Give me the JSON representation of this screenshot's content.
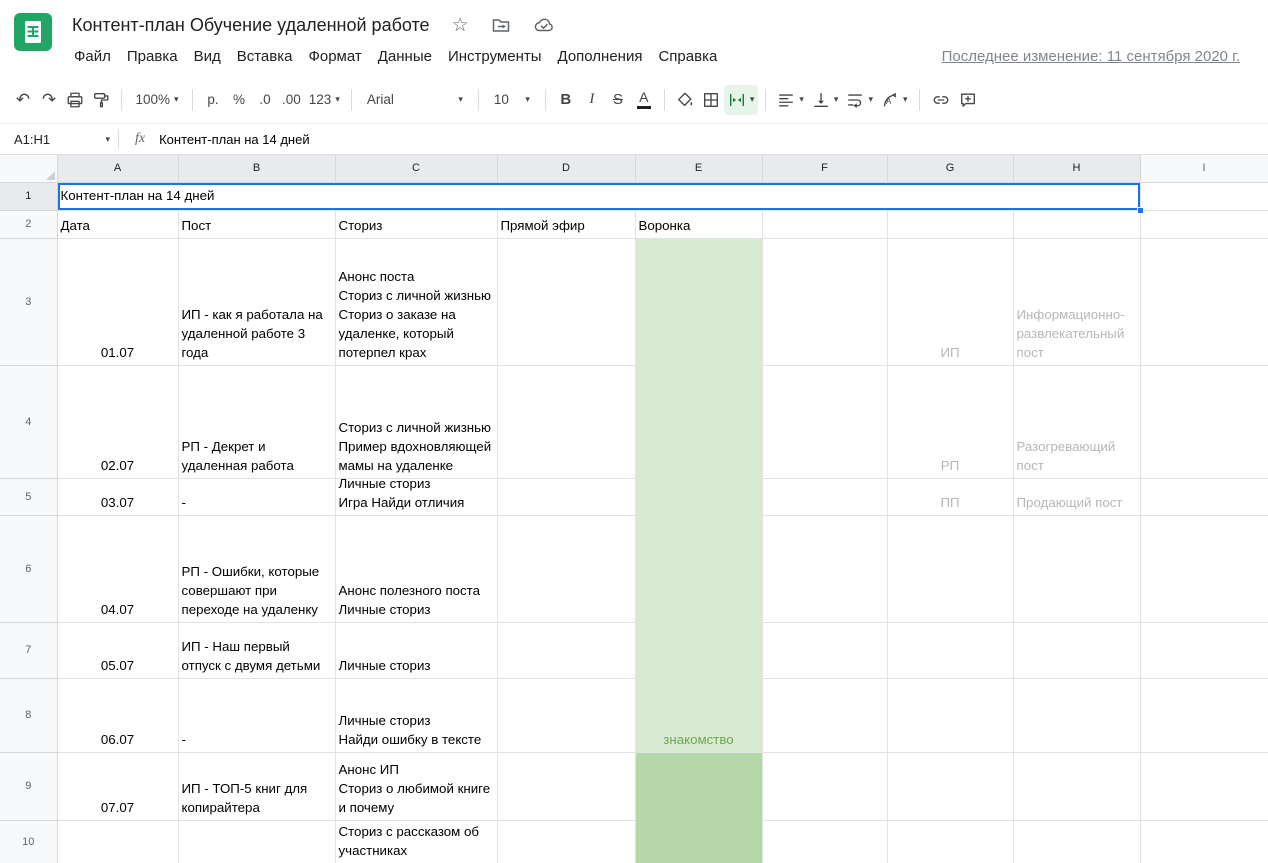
{
  "app": {
    "doc_title": "Контент-план Обучение удаленной работе",
    "last_edit_label": "Последнее изменение: 11 сентября 2020 г.",
    "menus": [
      "Файл",
      "Правка",
      "Вид",
      "Вставка",
      "Формат",
      "Данные",
      "Инструменты",
      "Дополнения",
      "Справка"
    ]
  },
  "icons": {
    "undo": "↶",
    "redo": "↷",
    "caret": "▾",
    "star": "☆"
  },
  "toolbar": {
    "zoom": "100%",
    "currency": "р.",
    "percent": "%",
    "decrease_decimal": ".0",
    "increase_decimal": ".00",
    "more_formats": "123",
    "font": "Arial",
    "font_size": "10",
    "bold": "B",
    "italic": "I",
    "strikethrough": "S",
    "text_color": "A"
  },
  "formula_bar": {
    "cell_ref": "A1:H1",
    "fx": "fx",
    "value": "Контент-план на 14 дней"
  },
  "sheet": {
    "col_headers": [
      "A",
      "B",
      "C",
      "D",
      "E",
      "F",
      "G",
      "H",
      "I"
    ],
    "row_headers": [
      "1",
      "2",
      "3",
      "4",
      "5",
      "6",
      "7",
      "8",
      "9",
      "10"
    ],
    "a1_title": "Контент-план на 14 дней",
    "headers": {
      "date": "Дата",
      "post": "Пост",
      "stories": "Сториз",
      "live": "Прямой эфир",
      "funnel": "Воронка"
    },
    "funnel_stage_1": "знакомство",
    "rows": [
      {
        "date": "01.07",
        "post": "ИП - как я работала на удаленной работе 3 года",
        "stories": "Анонс поста\nСториз с личной жизнью\nСториз о заказе на удаленке, который потерпел крах",
        "tag": "ИП",
        "type": "Информационно-развлекательный пост"
      },
      {
        "date": "02.07",
        "post": "РП - Декрет и удаленная работа",
        "stories": "Сториз с личной жизнью\nПример вдохновляющей мамы на удаленке",
        "tag": "РП",
        "type": "Разогревающий пост"
      },
      {
        "date": "03.07",
        "post": "-",
        "stories": "Личные сториз\nИгра Найди отличия",
        "tag": "ПП",
        "type": "Продающий пост"
      },
      {
        "date": "04.07",
        "post": "РП - Ошибки, которые совершают при переходе на удаленку",
        "stories": "Анонс полезного поста\nЛичные сториз",
        "tag": "",
        "type": ""
      },
      {
        "date": "05.07",
        "post": "ИП - Наш первый отпуск с двумя детьми",
        "stories": "Личные сториз",
        "tag": "",
        "type": ""
      },
      {
        "date": "06.07",
        "post": "-",
        "stories": "Личные сториз\nНайди ошибку в тексте",
        "tag": "",
        "type": ""
      },
      {
        "date": "07.07",
        "post": "ИП - ТОП-5 книг для копирайтера",
        "stories": "Анонс ИП\nСториз о любимой книге и почему",
        "tag": "",
        "type": ""
      },
      {
        "date": "",
        "post": "",
        "stories": "Сториз с рассказом об участниках",
        "tag": "",
        "type": ""
      }
    ],
    "colors": {
      "funnel_light_bg": "#d9ead3",
      "funnel_dark_bg": "#b6d7a8",
      "funnel_text": "#6aa84f",
      "muted_text": "#b7b7b7",
      "selection_blue": "#1a73e8",
      "sheets_green": "#23a566"
    }
  }
}
